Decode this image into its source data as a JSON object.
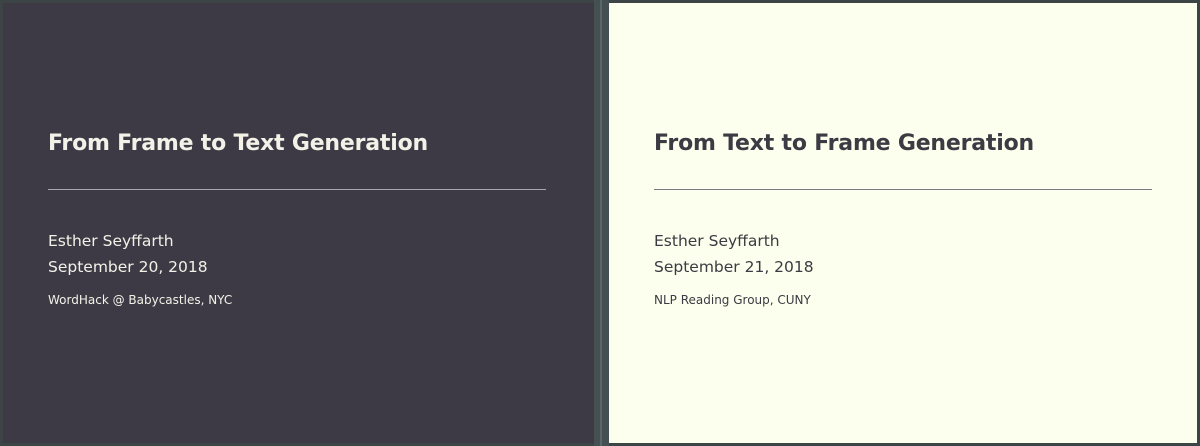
{
  "slides": [
    {
      "title": "From Frame to Text Generation",
      "author": "Esther Seyffarth",
      "date": "September 20, 2018",
      "venue": "WordHack @ Babycastles, NYC",
      "background": "#3d3a45",
      "text_color": "#f4f1e8"
    },
    {
      "title": "From Text to Frame Generation",
      "author": "Esther Seyffarth",
      "date": "September 21, 2018",
      "venue": "NLP Reading Group, CUNY",
      "background": "#fdffee",
      "text_color": "#3c3a42"
    }
  ]
}
